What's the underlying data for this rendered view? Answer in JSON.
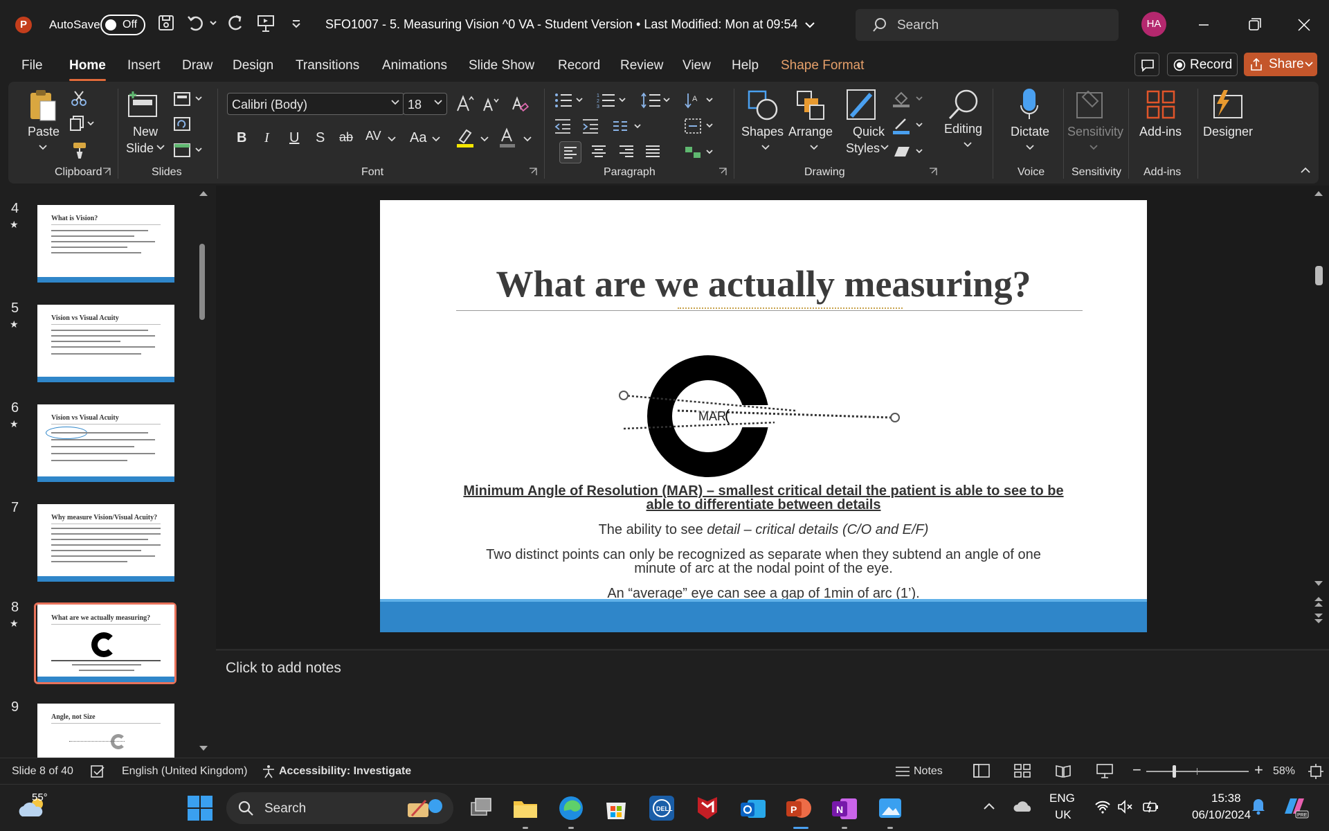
{
  "titlebar": {
    "autosave_label": "AutoSave",
    "autosave_state": "Off",
    "doc_title": "SFO1007 - 5. Measuring Vision ^0 VA - Student Version • Last Modified: Mon at 09:54",
    "search_placeholder": "Search",
    "user_initials": "HA"
  },
  "menu": {
    "tabs": [
      "File",
      "Home",
      "Insert",
      "Draw",
      "Design",
      "Transitions",
      "Animations",
      "Slide Show",
      "Record",
      "Review",
      "View",
      "Help",
      "Shape Format"
    ],
    "active": "Home",
    "record_label": "Record",
    "share_label": "Share"
  },
  "ribbon": {
    "clipboard": {
      "paste": "Paste",
      "group": "Clipboard"
    },
    "slides": {
      "new_slide_1": "New",
      "new_slide_2": "Slide",
      "group": "Slides"
    },
    "font": {
      "family": "Calibri (Body)",
      "size": "18",
      "group": "Font"
    },
    "paragraph": {
      "group": "Paragraph"
    },
    "drawing": {
      "shapes": "Shapes",
      "arrange": "Arrange",
      "quick_styles_1": "Quick",
      "quick_styles_2": "Styles",
      "group": "Drawing"
    },
    "editing": {
      "label": "Editing"
    },
    "voice": {
      "dictate": "Dictate",
      "group": "Voice"
    },
    "sensitivity": {
      "label": "Sensitivity",
      "group": "Sensitivity"
    },
    "addins": {
      "label": "Add-ins",
      "group": "Add-ins"
    },
    "designer": {
      "label": "Designer"
    }
  },
  "thumbnails": [
    {
      "num": "4",
      "title": "What is Vision?"
    },
    {
      "num": "5",
      "title": "Vision vs Visual Acuity"
    },
    {
      "num": "6",
      "title": "Vision vs Visual Acuity"
    },
    {
      "num": "7",
      "title": "Why measure Vision/Visual Acuity?"
    },
    {
      "num": "8",
      "title": "What are we actually measuring?"
    },
    {
      "num": "9",
      "title": "Angle, not Size"
    }
  ],
  "slide": {
    "title": "What are we actually measuring?",
    "mar_label": "MAR",
    "line1a": "Minimum Angle of Resolution (MAR) – smallest critical detail the patient is able to see to be",
    "line1b": "able to differentiate between details",
    "line2_pre": "The ability to see ",
    "line2_italic": "detail – critical details (C/O and E/F)",
    "line3a": "Two distinct points can only be recognized as separate when they subtend an angle of one",
    "line3b": "minute of arc at the nodal point of the eye.",
    "line4": "An “average” eye can see a gap of 1min of arc (1’)."
  },
  "notes": {
    "placeholder": "Click to add notes"
  },
  "status": {
    "slide_of": "Slide 8 of 40",
    "language": "English (United Kingdom)",
    "accessibility": "Accessibility: Investigate",
    "notes": "Notes",
    "zoom": "58%"
  },
  "taskbar": {
    "weather": "55°",
    "search": "Search",
    "lang1": "ENG",
    "lang2": "UK",
    "time": "15:38",
    "date": "06/10/2024"
  }
}
